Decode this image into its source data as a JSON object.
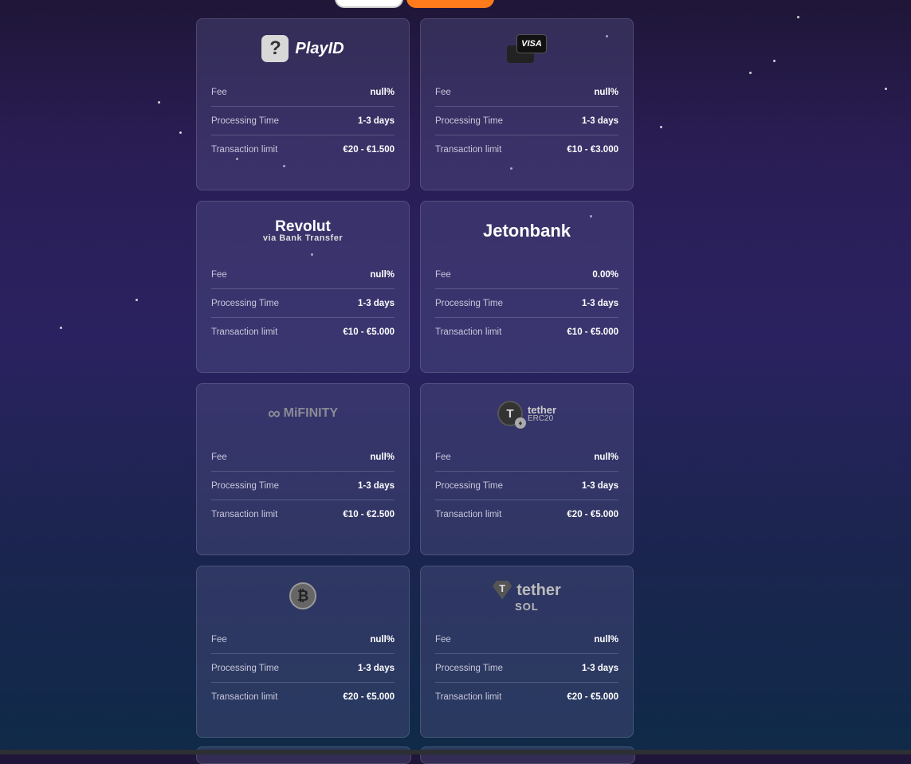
{
  "labels": {
    "fee": "Fee",
    "processing_time": "Processing Time",
    "transaction_limit": "Transaction limit"
  },
  "cards": [
    {
      "provider": "PlayID",
      "logo_text": "PlayID",
      "logo_icon": "question-mark-icon",
      "fee": "null%",
      "processing_time": "1-3 days",
      "limit": "€20 - €1.500"
    },
    {
      "provider": "Visa",
      "logo_text": "VISA",
      "logo_icon": "card-icon",
      "fee": "null%",
      "processing_time": "1-3 days",
      "limit": "€10 - €3.000"
    },
    {
      "provider": "Revolut",
      "logo_text": "Revolut",
      "logo_sub": "via Bank Transfer",
      "fee": "null%",
      "processing_time": "1-3 days",
      "limit": "€10 - €5.000"
    },
    {
      "provider": "Jetonbank",
      "logo_text": "Jetonbank",
      "fee": "0.00%",
      "processing_time": "1-3 days",
      "limit": "€10 - €5.000"
    },
    {
      "provider": "MiFinity",
      "logo_text": "MiFINITY",
      "logo_icon": "infinity-icon",
      "fee": "null%",
      "processing_time": "1-3 days",
      "limit": "€10 - €2.500"
    },
    {
      "provider": "Tether ERC20",
      "logo_text": "tether",
      "logo_sub": "ERC20",
      "logo_icon": "tether-coin-icon",
      "fee": "null%",
      "processing_time": "1-3 days",
      "limit": "€20 - €5.000"
    },
    {
      "provider": "Bitcoin",
      "logo_icon": "bitcoin-icon",
      "fee": "null%",
      "processing_time": "1-3 days",
      "limit": "€20 - €5.000"
    },
    {
      "provider": "Tether SOL",
      "logo_text": "tether",
      "logo_sub": "SOL",
      "logo_icon": "tether-diamond-icon",
      "fee": "null%",
      "processing_time": "1-3 days",
      "limit": "€20 - €5.000"
    }
  ],
  "colors": {
    "accent": "#ff7a1a",
    "card_bg": "rgba(90,90,140,.35)"
  }
}
